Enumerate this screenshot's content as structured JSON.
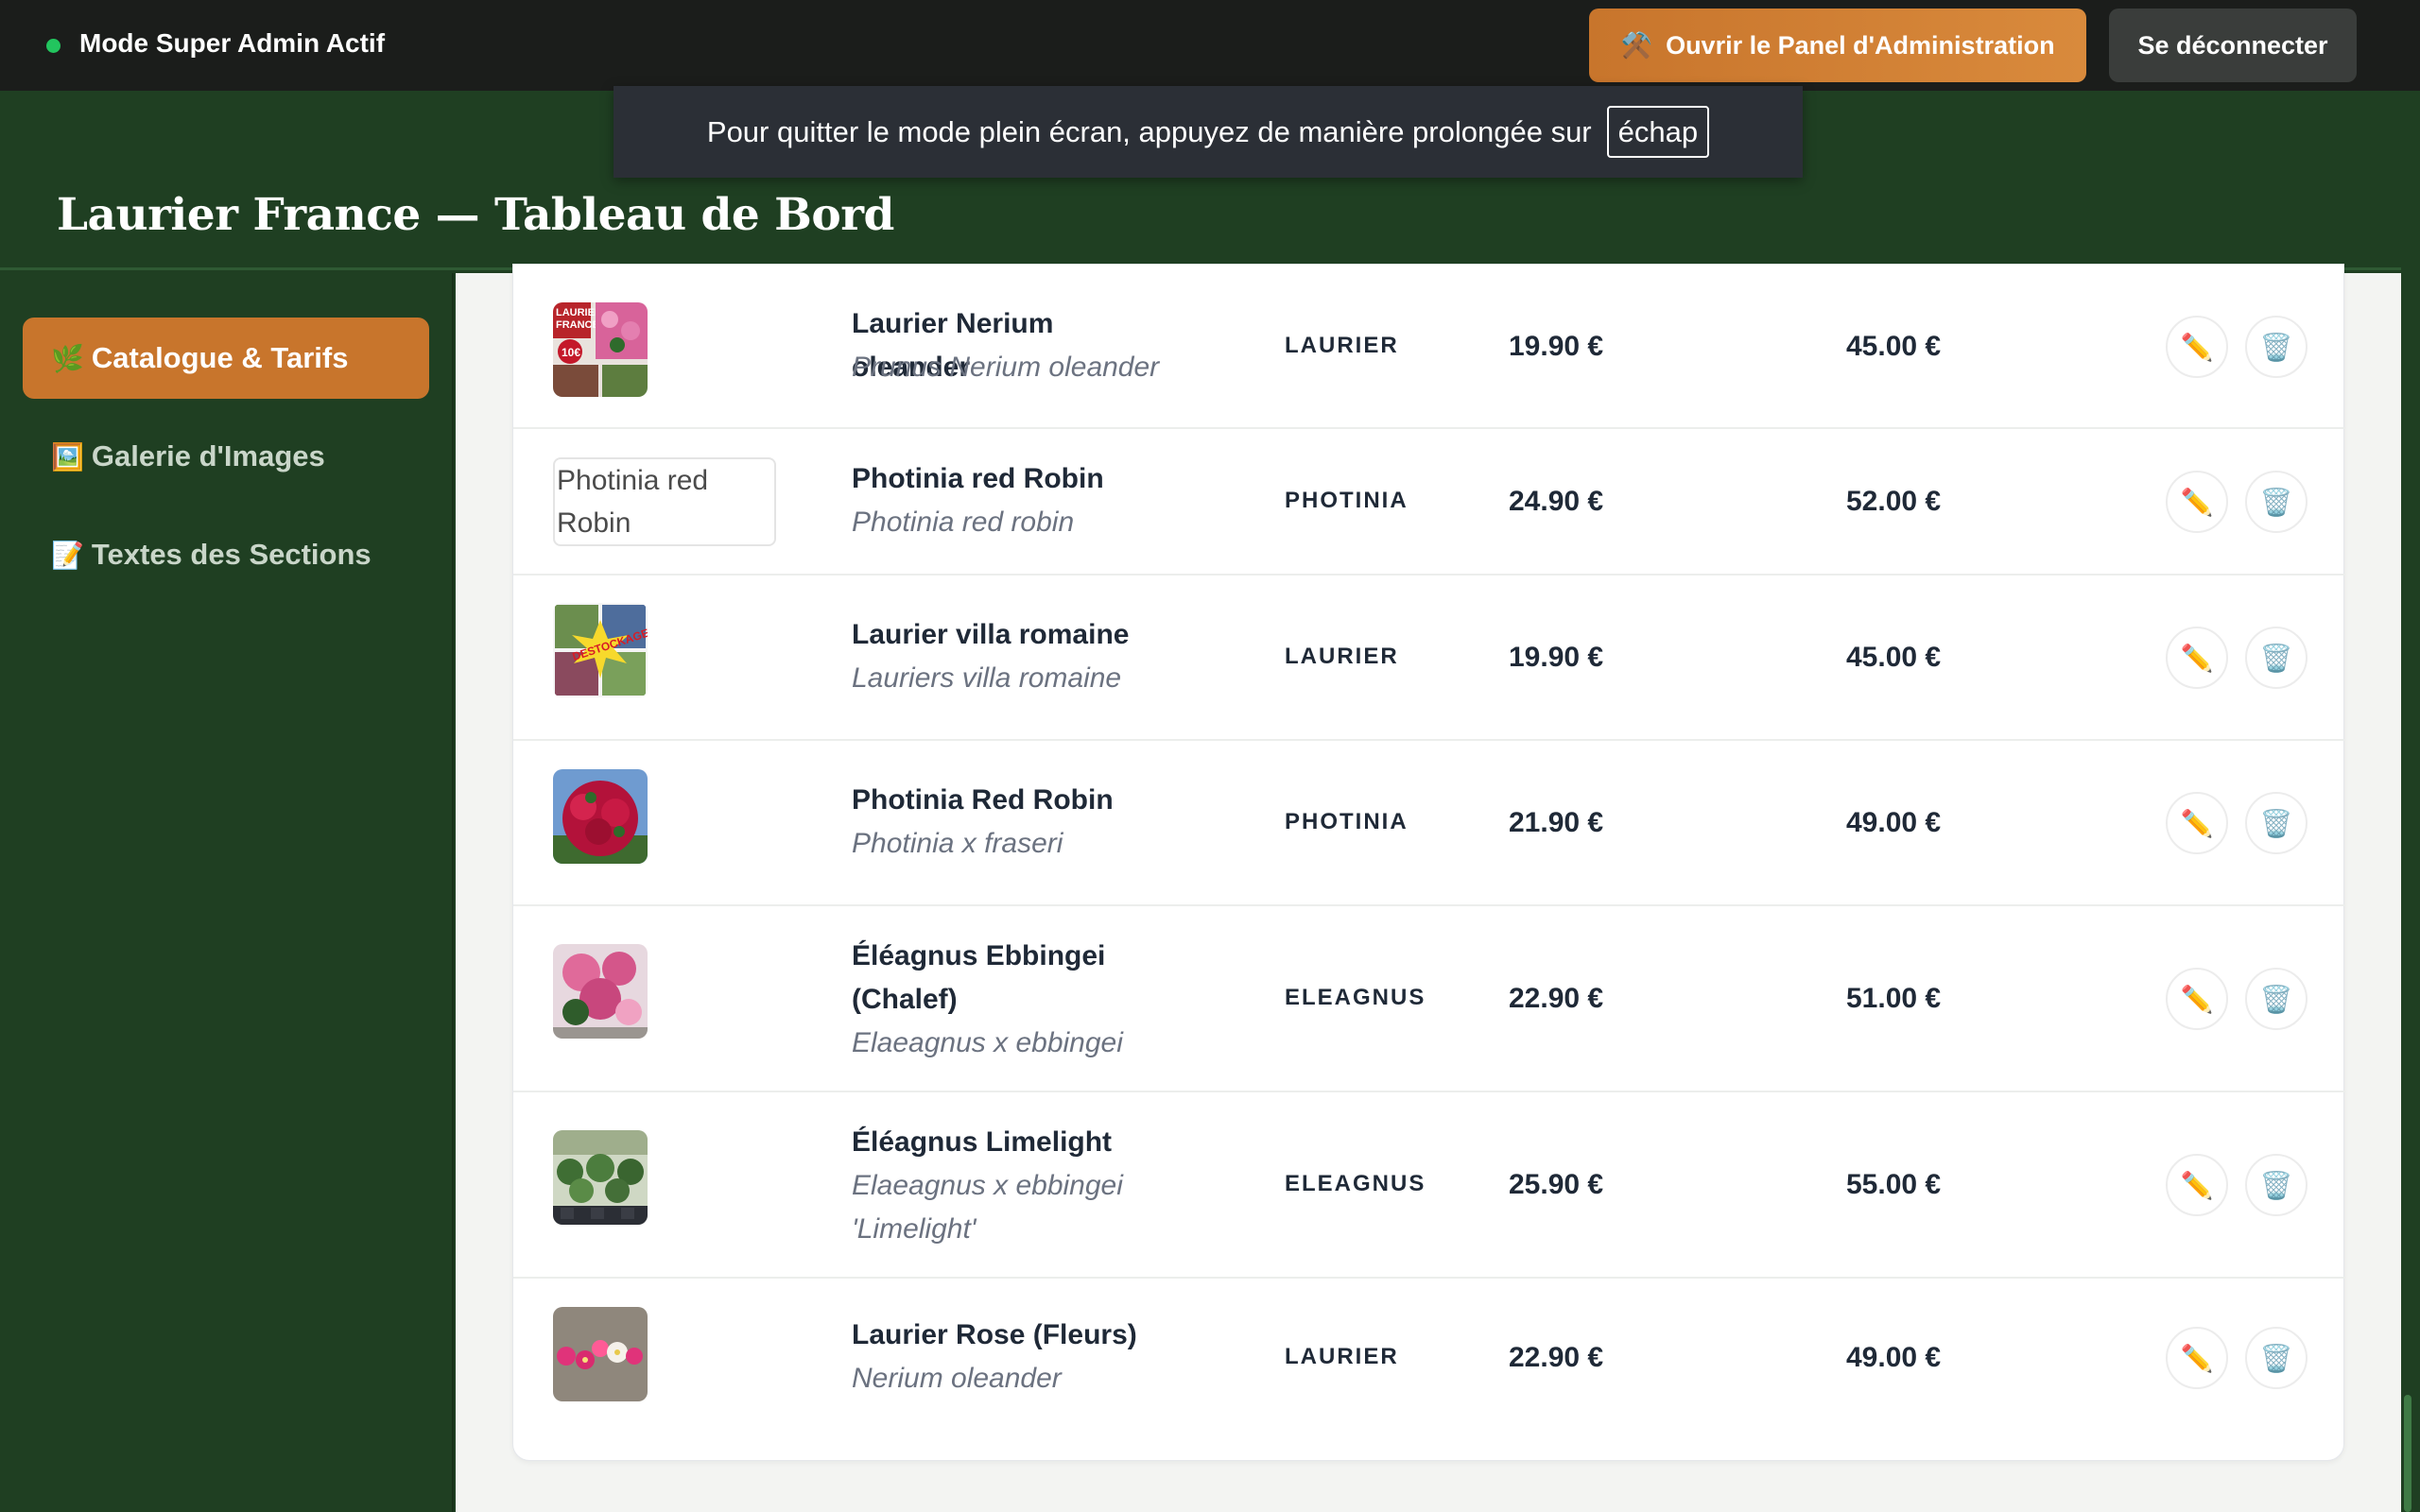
{
  "admin_bar": {
    "mode_label": "Mode Super Admin Actif",
    "panel_button": "Ouvrir le Panel d'Administration",
    "panel_icon": "⚒️",
    "logout_button": "Se déconnecter"
  },
  "fullscreen_toast": {
    "text": "Pour quitter le mode plein écran, appuyez de manière prolongée sur",
    "key": "échap"
  },
  "header": {
    "title": "Laurier France — Tableau de Bord"
  },
  "sidebar": {
    "items": [
      {
        "icon": "🌿",
        "label": "Catalogue & Tarifs",
        "active": true
      },
      {
        "icon": "🖼️",
        "label": "Galerie d'Images",
        "active": false
      },
      {
        "icon": "📝",
        "label": "Textes des Sections",
        "active": false
      }
    ]
  },
  "products": [
    {
      "name": "Laurier Nerium oleander",
      "latin": "Prunus Nerium oleander",
      "category": "LAURIER",
      "price1": "19.90 €",
      "price2": "45.00 €",
      "thumb": "promo-poster"
    },
    {
      "name": "Photinia red Robin",
      "latin": "Photinia red robin",
      "category": "PHOTINIA",
      "price1": "24.90 €",
      "price2": "52.00 €",
      "thumb_alt": "Photinia red Robin"
    },
    {
      "name": "Laurier villa romaine",
      "latin": "Lauriers villa romaine",
      "category": "LAURIER",
      "price1": "19.90 €",
      "price2": "45.00 €",
      "thumb": "destockage-collage"
    },
    {
      "name": "Photinia Red Robin",
      "latin": "Photinia x fraseri",
      "category": "PHOTINIA",
      "price1": "21.90 €",
      "price2": "49.00 €",
      "thumb": "red-shrub"
    },
    {
      "name": "Éléagnus Ebbingei (Chalef)",
      "latin": "Elaeagnus x ebbingei",
      "category": "ELEAGNUS",
      "price1": "22.90 €",
      "price2": "51.00 €",
      "thumb": "pink-flowers"
    },
    {
      "name": "Éléagnus Limelight",
      "latin": "Elaeagnus x ebbingei 'Limelight'",
      "category": "ELEAGNUS",
      "price1": "25.90 €",
      "price2": "55.00 €",
      "thumb": "nursery-pots"
    },
    {
      "name": "Laurier Rose (Fleurs)",
      "latin": "Nerium oleander",
      "category": "LAURIER",
      "price1": "22.90 €",
      "price2": "49.00 €",
      "thumb": "flowers-on-gravel"
    }
  ],
  "actions": {
    "edit_icon": "✏️",
    "delete_icon": "🗑️"
  },
  "colors": {
    "accent": "#c8752c",
    "sidebar_bg": "#1f3f22",
    "status_dot": "#22c55e"
  }
}
